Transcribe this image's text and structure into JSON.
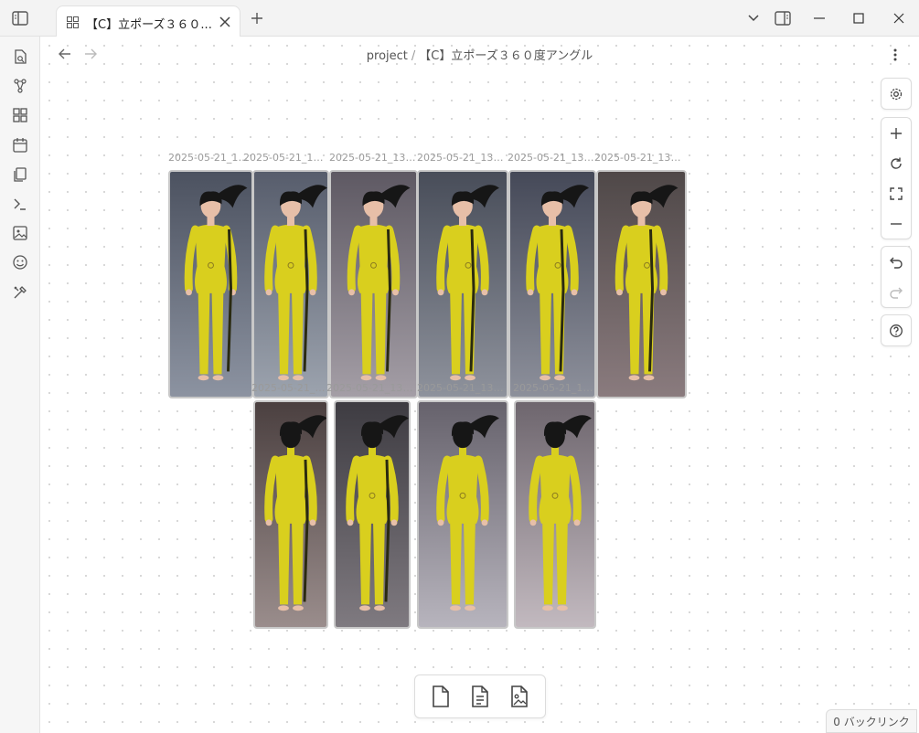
{
  "app": {
    "tab_title": "【C】立ポーズ３６０...",
    "icons": [
      "sidebar-toggle-icon",
      "grid-icon",
      "close-icon",
      "plus-icon",
      "chevron-down-icon",
      "right-sidebar-icon",
      "minimize-icon",
      "maximize-icon",
      "close-window-icon"
    ]
  },
  "ribbon": {
    "items": [
      {
        "name": "open-quick-switcher-icon"
      },
      {
        "name": "graph-view-icon"
      },
      {
        "name": "canvas-icon"
      },
      {
        "name": "daily-note-icon"
      },
      {
        "name": "templates-icon"
      },
      {
        "name": "command-palette-icon"
      },
      {
        "name": "image-icon"
      },
      {
        "name": "emoji-icon"
      },
      {
        "name": "tools-icon"
      }
    ]
  },
  "breadcrumb": {
    "parent": "project",
    "separator": "/",
    "current": "【C】立ポーズ３６０度アングル"
  },
  "canvas": {
    "cards": [
      {
        "label": "2025-05-21_13...",
        "inner": ""
      },
      {
        "label": "2025-05-21_13h...",
        "inner": "2025-05-21_1..."
      },
      {
        "label": "2025-05-21_13h...",
        "inner": "2025-05-21_13h..."
      },
      {
        "label": "2025-05-21_13h...",
        "inner": "2025-05-21_13h..."
      },
      {
        "label": "2025-05-21_13h...",
        "inner": "2025-05-21_13..."
      },
      {
        "label": "2025-05-21_13h...",
        "inner": ""
      },
      {
        "label": "",
        "inner": ""
      },
      {
        "label": "",
        "inner": ""
      },
      {
        "label": "",
        "inner": ""
      },
      {
        "label": "",
        "inner": ""
      }
    ],
    "colors": {
      "suit": "#d9cf1e",
      "stripe": "#2a2a10",
      "hair": "#161616",
      "skin": "#e7bfa8"
    }
  },
  "controls": {
    "groups": [
      [
        "settings-icon"
      ],
      [
        "zoom-in-icon",
        "reset-zoom-icon",
        "fit-to-screen-icon",
        "zoom-out-icon"
      ],
      [
        "undo-icon",
        "redo-icon"
      ],
      [
        "help-icon"
      ]
    ]
  },
  "bottom_toolbar": [
    "add-card-icon",
    "add-note-icon",
    "add-media-icon"
  ],
  "backlinks": {
    "text": "0 バックリンク"
  }
}
